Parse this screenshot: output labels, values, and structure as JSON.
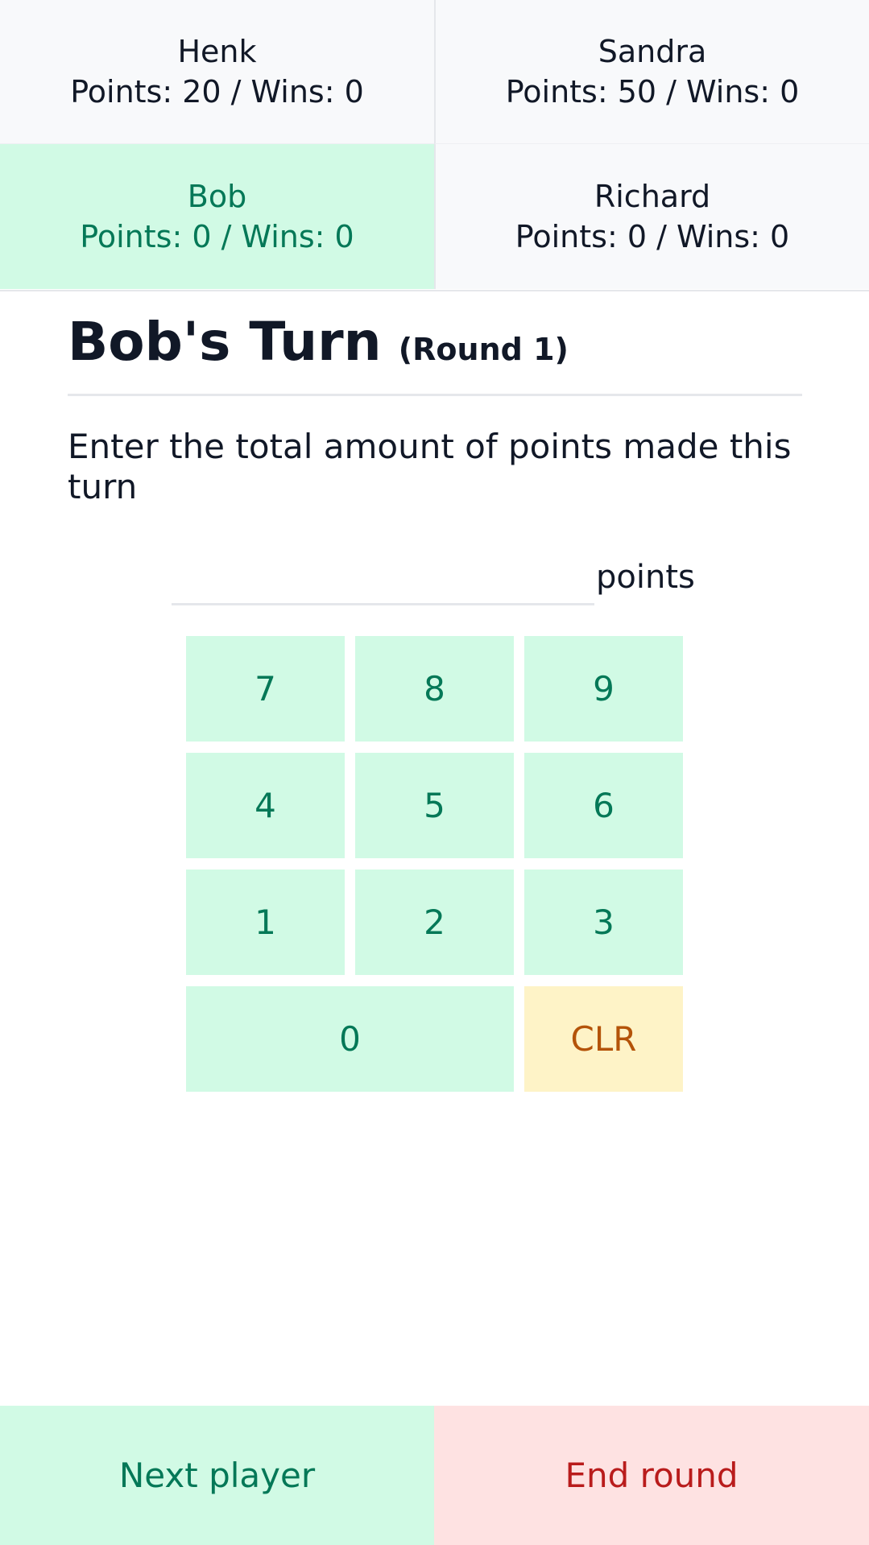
{
  "players": [
    {
      "name": "Henk",
      "stats": "Points: 20 / Wins: 0",
      "active": false
    },
    {
      "name": "Sandra",
      "stats": "Points: 50 / Wins: 0",
      "active": false
    },
    {
      "name": "Bob",
      "stats": "Points: 0 / Wins: 0",
      "active": true
    },
    {
      "name": "Richard",
      "stats": "Points: 0 / Wins: 0",
      "active": false
    }
  ],
  "turn": {
    "title": "Bob's Turn",
    "round": "(Round 1)"
  },
  "instructions": "Enter the total amount of points made this turn",
  "points_input": {
    "value": "",
    "unit": "points"
  },
  "keypad": {
    "keys": [
      "7",
      "8",
      "9",
      "4",
      "5",
      "6",
      "1",
      "2",
      "3",
      "0"
    ],
    "clear": "CLR"
  },
  "footer": {
    "next_label": "Next player",
    "end_label": "End round"
  },
  "colors": {
    "active_bg": "#d1fae5",
    "active_text": "#047857",
    "clear_bg": "#fef3c7",
    "clear_text": "#b45309",
    "danger_bg": "#fee2e2",
    "danger_text": "#b91c1c",
    "panel_bg": "#f8f9fb"
  }
}
